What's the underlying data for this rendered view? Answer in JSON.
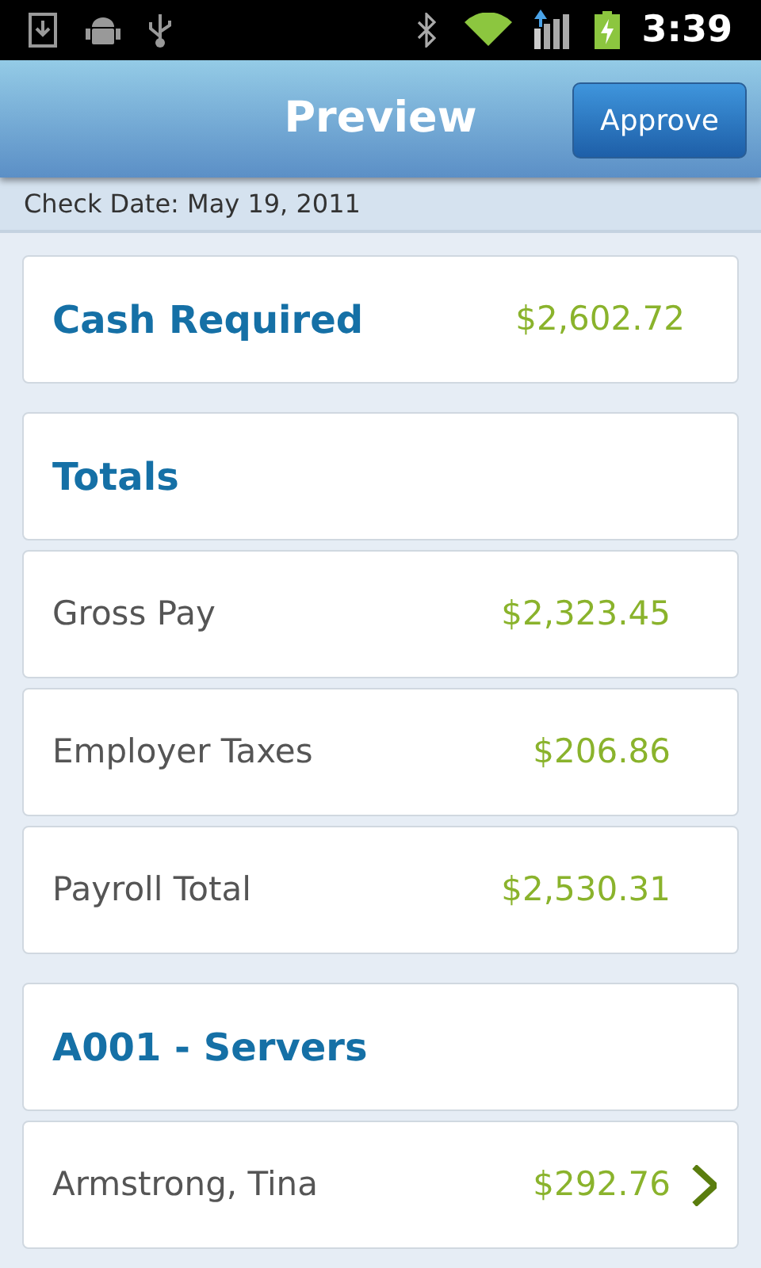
{
  "status_bar": {
    "time": "3:39"
  },
  "header": {
    "title": "Preview",
    "button": "Approve"
  },
  "check_date": "Check Date: May 19, 2011",
  "groups": [
    {
      "items": [
        {
          "kind": "heading",
          "label": "Cash Required",
          "amount": "$2,602.72"
        }
      ]
    },
    {
      "items": [
        {
          "kind": "heading",
          "label": "Totals"
        },
        {
          "kind": "row",
          "label": "Gross Pay",
          "amount": "$2,323.45",
          "chevron": false
        },
        {
          "kind": "row",
          "label": "Employer Taxes",
          "amount": "$206.86",
          "chevron": false
        },
        {
          "kind": "row",
          "label": "Payroll Total",
          "amount": "$2,530.31",
          "chevron": false
        }
      ]
    },
    {
      "items": [
        {
          "kind": "heading",
          "label": "A001 - Servers"
        },
        {
          "kind": "row",
          "label": "Armstrong, Tina",
          "amount": "$292.76",
          "chevron": true
        }
      ]
    }
  ]
}
